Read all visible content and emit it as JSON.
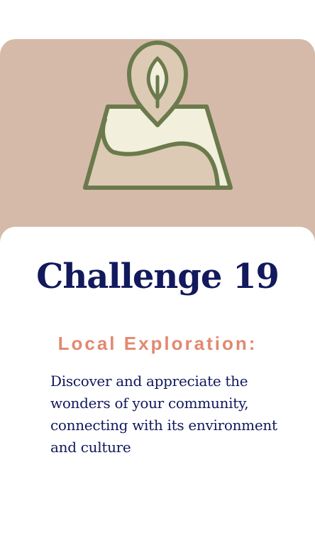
{
  "card": {
    "icon": "map-pin-leaf-icon",
    "title": "Challenge 19",
    "subtitle": "Local Exploration:",
    "description": "Discover and appreciate the wonders of your community, connecting with its environment and culture"
  },
  "colors": {
    "hero_background": "#d5baa9",
    "icon_stroke": "#6b7a4c",
    "title": "#12195c",
    "subtitle": "#e38870",
    "body": "#12195c"
  }
}
